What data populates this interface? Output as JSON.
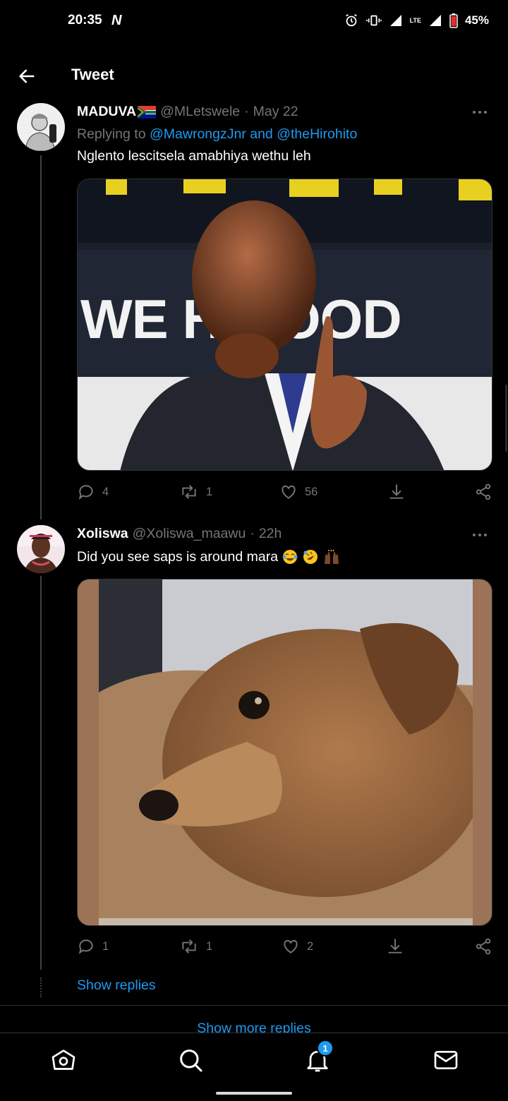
{
  "status_bar": {
    "time": "20:35",
    "carrier_logo": "N",
    "lte": "LTE",
    "battery": "45%",
    "icons": [
      "alarm-icon",
      "vibrate-icon",
      "signal-icon",
      "battery-icon"
    ]
  },
  "header": {
    "title": "Tweet",
    "back_icon": "arrow-left-icon"
  },
  "tweets": [
    {
      "name": "MADUVA",
      "flag": "south-africa-flag-emoji",
      "handle": "@MLetswele",
      "separator": "·",
      "date": "May 22",
      "replying_prefix": "Replying to",
      "replying_to": "@MawrongzJnr and @theHirohito",
      "text": "Nglento lescitsela amabhiya wethu  leh",
      "media": "photo of a bald man in a dark suit and blue tie raising his index finger in front of a banner reading WE H... GOOD",
      "banner_text": "WE H   GOOD",
      "replies": "4",
      "retweets": "1",
      "likes": "56"
    },
    {
      "name": "Xoliswa",
      "handle": "@Xoliswa_maawu",
      "separator": "·",
      "date": "22h",
      "text": "Did you see saps is around mara",
      "emojis": [
        "tears-of-joy-emoji",
        "rolling-laughing-emoji",
        "raising-hands-emoji"
      ],
      "media": "photo of a brown dog looking sideways",
      "replies": "1",
      "retweets": "1",
      "likes": "2"
    }
  ],
  "show_replies": "Show replies",
  "show_more_replies": "Show more replies",
  "bottom_nav": {
    "items": [
      "home-icon",
      "search-icon",
      "notifications-icon",
      "messages-icon"
    ],
    "notification_badge": "1"
  },
  "colors": {
    "background": "#000000",
    "accent": "#1d9bf0",
    "muted": "#71767b",
    "divider": "#2f3336"
  }
}
